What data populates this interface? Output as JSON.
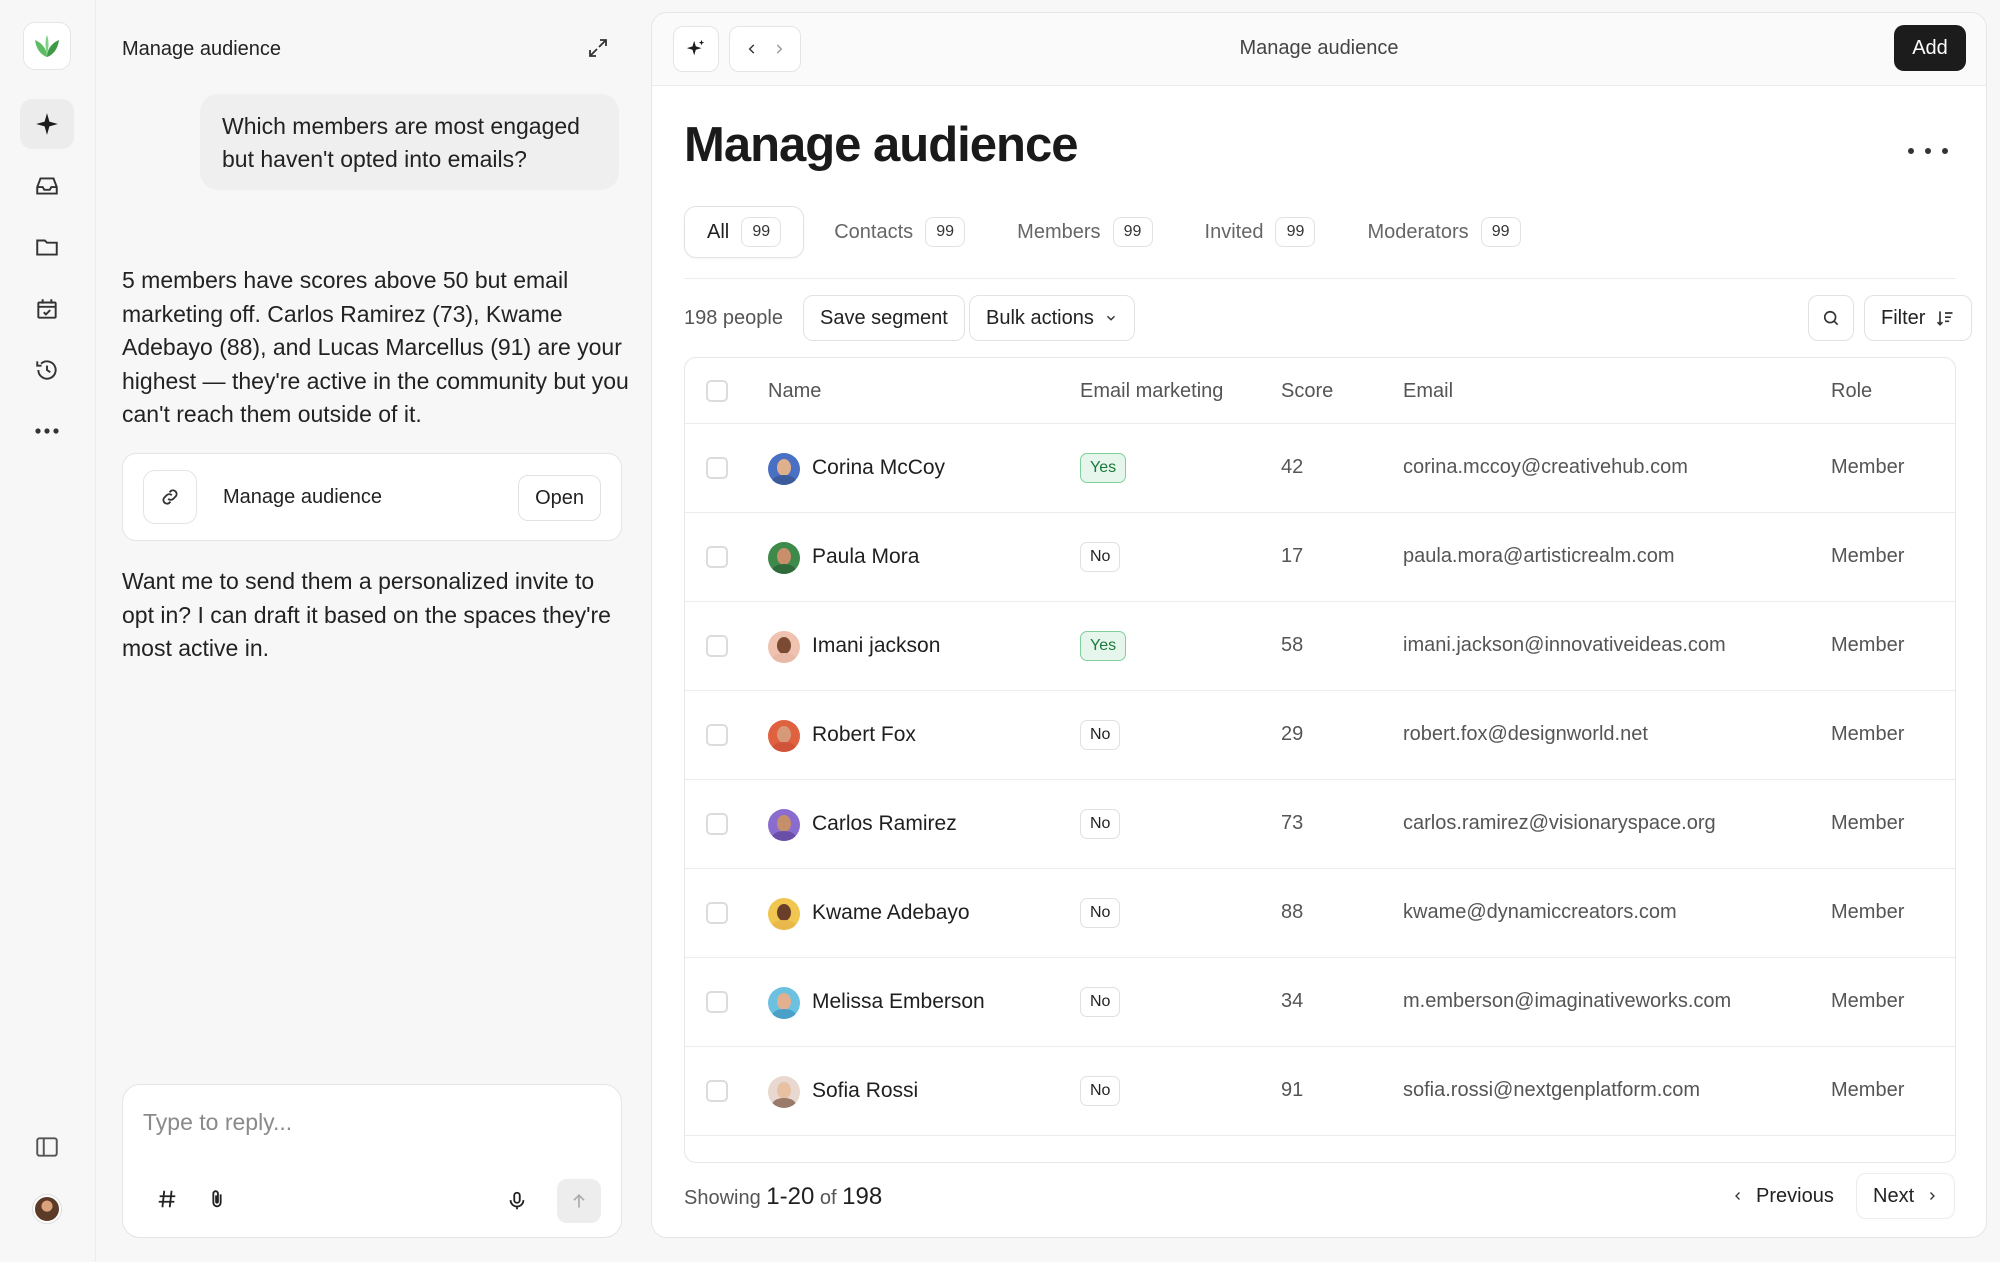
{
  "colors": {
    "accent_dark": "#1c1c1c",
    "yes_bg": "#e6f6ec",
    "yes_border": "#7fd19a",
    "logo_green": "#4caf50"
  },
  "rail": {
    "logo": "leaf-logo",
    "items": [
      {
        "icon": "sparkle-icon",
        "active": true
      },
      {
        "icon": "inbox-icon",
        "active": false
      },
      {
        "icon": "folder-icon",
        "active": false
      },
      {
        "icon": "calendar-check-icon",
        "active": false
      },
      {
        "icon": "history-icon",
        "active": false
      },
      {
        "icon": "more-horizontal-icon",
        "active": false
      }
    ],
    "bottom": [
      {
        "icon": "sidebar-toggle-icon"
      },
      {
        "icon": "user-avatar"
      }
    ]
  },
  "chat": {
    "title": "Manage audience",
    "user_message": "Which members are most engaged but haven't opted into emails?",
    "ai_message_1": "5 members have scores above 50 but email marketing off. Carlos Ramirez (73), Kwame Adebayo (88), and Lucas Marcellus (91) are your highest — they're active in the community but you can't reach them outside of it.",
    "link_card": {
      "label": "Manage audience",
      "button": "Open"
    },
    "ai_message_2": "Want me to send them a personalized invite to opt in? I can draft it based on the spaces they're most active in.",
    "composer": {
      "placeholder": "Type to reply..."
    }
  },
  "main": {
    "topbar_title": "Manage audience",
    "add_label": "Add",
    "page_title": "Manage audience",
    "tabs": [
      {
        "label": "All",
        "count": "99",
        "active": true
      },
      {
        "label": "Contacts",
        "count": "99",
        "active": false
      },
      {
        "label": "Members",
        "count": "99",
        "active": false
      },
      {
        "label": "Invited",
        "count": "99",
        "active": false
      },
      {
        "label": "Moderators",
        "count": "99",
        "active": false
      }
    ],
    "toolbar": {
      "people_count": "198 people",
      "save_segment": "Save segment",
      "bulk_actions": "Bulk actions",
      "filter": "Filter"
    },
    "table": {
      "headers": {
        "name": "Name",
        "email_marketing": "Email marketing",
        "score": "Score",
        "email": "Email",
        "role": "Role"
      },
      "rows": [
        {
          "name": "Corina McCoy",
          "email_marketing": "Yes",
          "score": "42",
          "email": "corina.mccoy@creativehub.com",
          "role": "Member",
          "skin": "#e0b08c",
          "shirt": "#3b5b9a",
          "ring": "#4a70c4"
        },
        {
          "name": "Paula Mora",
          "email_marketing": "No",
          "score": "17",
          "email": "paula.mora@artisticrealm.com",
          "role": "Member",
          "skin": "#c98f6a",
          "shirt": "#2f6b3a",
          "ring": "#3e8a4a"
        },
        {
          "name": "Imani jackson",
          "email_marketing": "Yes",
          "score": "58",
          "email": "imani.jackson@innovativeideas.com",
          "role": "Member",
          "skin": "#7a4a33",
          "shirt": "#e9b9a8",
          "ring": "#f0c2b0"
        },
        {
          "name": "Robert Fox",
          "email_marketing": "No",
          "score": "29",
          "email": "robert.fox@designworld.net",
          "role": "Member",
          "skin": "#d79a78",
          "shirt": "#d0543a",
          "ring": "#e0613f"
        },
        {
          "name": "Carlos Ramirez",
          "email_marketing": "No",
          "score": "73",
          "email": "carlos.ramirez@visionaryspace.org",
          "role": "Member",
          "skin": "#c68f6c",
          "shirt": "#6a4fa8",
          "ring": "#8a6ccf"
        },
        {
          "name": "Kwame Adebayo",
          "email_marketing": "No",
          "score": "88",
          "email": "kwame@dynamiccreators.com",
          "role": "Member",
          "skin": "#6a3f2a",
          "shirt": "#e8b94a",
          "ring": "#f0c550"
        },
        {
          "name": "Melissa Emberson",
          "email_marketing": "No",
          "score": "34",
          "email": "m.emberson@imaginativeworks.com",
          "role": "Member",
          "skin": "#e2b08f",
          "shirt": "#4aa0c8",
          "ring": "#6cc0e0"
        },
        {
          "name": "Sofia Rossi",
          "email_marketing": "No",
          "score": "91",
          "email": "sofia.rossi@nextgenplatform.com",
          "role": "Member",
          "skin": "#e8c0a2",
          "shirt": "#9a7a6a",
          "ring": "#e8d8d0"
        }
      ]
    },
    "footer": {
      "showing_prefix": "Showing",
      "range": "1-20",
      "of": "of",
      "total": "198",
      "previous": "Previous",
      "next": "Next"
    }
  }
}
